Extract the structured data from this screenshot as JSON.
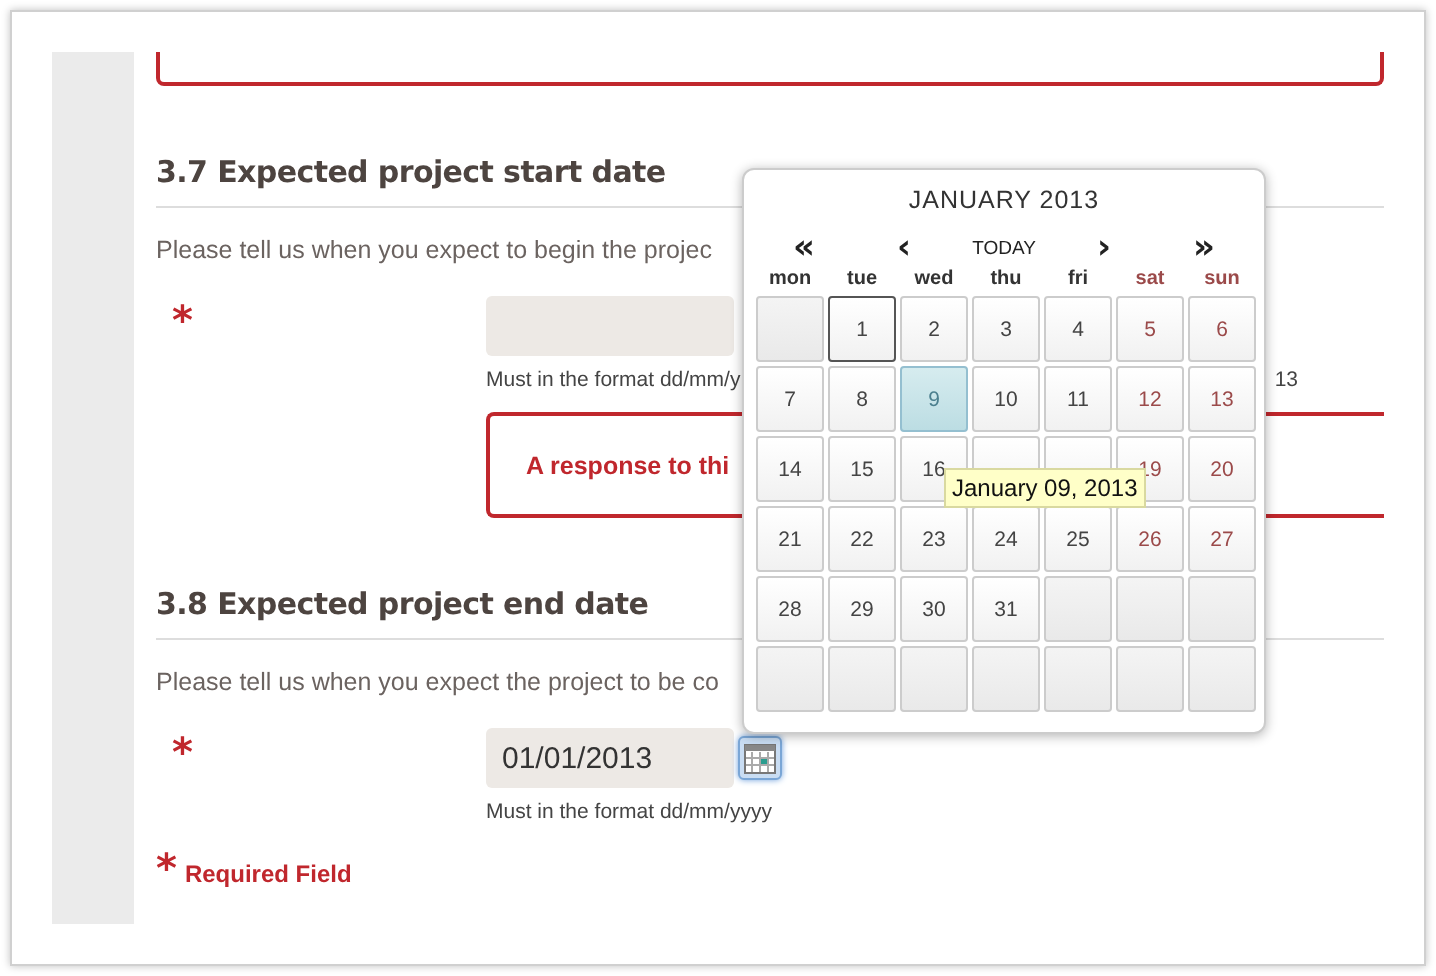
{
  "sections": [
    {
      "heading": "3.7 Expected project start date",
      "prompt": "Please tell us when you expect to begin the projec",
      "required_mark": "*",
      "field": {
        "hint": "Must in the format dd/mm/y",
        "hint_tail": "13"
      },
      "error": "A response to thi"
    },
    {
      "heading": "3.8 Expected project end date",
      "prompt": "Please tell us when you expect the project to be co",
      "required_mark": "*",
      "field": {
        "value": "01/01/2013",
        "picker_button": true,
        "picker_active": true,
        "hint": "Must in the format dd/mm/yyyy"
      }
    }
  ],
  "required_note": {
    "mark": "*",
    "text": "Required Field"
  },
  "calendar": {
    "title": "JANUARY 2013",
    "nav": [
      {
        "label": "«",
        "kind": "arrow"
      },
      {
        "label": "‹",
        "kind": "arrow"
      },
      {
        "label": "TODAY",
        "kind": "link"
      },
      {
        "label": "›",
        "kind": "arrow"
      },
      {
        "label": "»",
        "kind": "arrow"
      }
    ],
    "weekdays": [
      {
        "label": "mon",
        "weekend": false
      },
      {
        "label": "tue",
        "weekend": false
      },
      {
        "label": "wed",
        "weekend": false
      },
      {
        "label": "thu",
        "weekend": false
      },
      {
        "label": "fri",
        "weekend": false
      },
      {
        "label": "sat",
        "weekend": true
      },
      {
        "label": "sun",
        "weekend": true
      }
    ],
    "cells": [
      {
        "kind": "empty",
        "selected": false,
        "hovered": false
      },
      {
        "kind": "day",
        "day": "1",
        "weekend": false,
        "selected": true,
        "hovered": false
      },
      {
        "kind": "day",
        "day": "2",
        "weekend": false,
        "selected": false,
        "hovered": false
      },
      {
        "kind": "day",
        "day": "3",
        "weekend": false,
        "selected": false,
        "hovered": false
      },
      {
        "kind": "day",
        "day": "4",
        "weekend": false,
        "selected": false,
        "hovered": false
      },
      {
        "kind": "day",
        "day": "5",
        "weekend": true,
        "selected": false,
        "hovered": false
      },
      {
        "kind": "day",
        "day": "6",
        "weekend": true,
        "selected": false,
        "hovered": false
      },
      {
        "kind": "day",
        "day": "7",
        "weekend": false,
        "selected": false,
        "hovered": false
      },
      {
        "kind": "day",
        "day": "8",
        "weekend": false,
        "selected": false,
        "hovered": false
      },
      {
        "kind": "day",
        "day": "9",
        "weekend": false,
        "selected": false,
        "hovered": true
      },
      {
        "kind": "day",
        "day": "10",
        "weekend": false,
        "selected": false,
        "hovered": false
      },
      {
        "kind": "day",
        "day": "11",
        "weekend": false,
        "selected": false,
        "hovered": false
      },
      {
        "kind": "day",
        "day": "12",
        "weekend": true,
        "selected": false,
        "hovered": false
      },
      {
        "kind": "day",
        "day": "13",
        "weekend": true,
        "selected": false,
        "hovered": false
      },
      {
        "kind": "day",
        "day": "14",
        "weekend": false,
        "selected": false,
        "hovered": false
      },
      {
        "kind": "day",
        "day": "15",
        "weekend": false,
        "selected": false,
        "hovered": false
      },
      {
        "kind": "day",
        "day": "16",
        "weekend": false,
        "selected": false,
        "hovered": false
      },
      {
        "kind": "day",
        "selected": false,
        "hovered": false
      },
      {
        "kind": "day",
        "selected": false,
        "hovered": false
      },
      {
        "kind": "day",
        "day": "19",
        "weekend": true,
        "selected": false,
        "hovered": false
      },
      {
        "kind": "day",
        "day": "20",
        "weekend": true,
        "selected": false,
        "hovered": false
      },
      {
        "kind": "day",
        "day": "21",
        "weekend": false,
        "selected": false,
        "hovered": false
      },
      {
        "kind": "day",
        "day": "22",
        "weekend": false,
        "selected": false,
        "hovered": false
      },
      {
        "kind": "day",
        "day": "23",
        "weekend": false,
        "selected": false,
        "hovered": false
      },
      {
        "kind": "day",
        "day": "24",
        "weekend": false,
        "selected": false,
        "hovered": false
      },
      {
        "kind": "day",
        "day": "25",
        "weekend": false,
        "selected": false,
        "hovered": false
      },
      {
        "kind": "day",
        "day": "26",
        "weekend": true,
        "selected": false,
        "hovered": false
      },
      {
        "kind": "day",
        "day": "27",
        "weekend": true,
        "selected": false,
        "hovered": false
      },
      {
        "kind": "day",
        "day": "28",
        "weekend": false,
        "selected": false,
        "hovered": false
      },
      {
        "kind": "day",
        "day": "29",
        "weekend": false,
        "selected": false,
        "hovered": false
      },
      {
        "kind": "day",
        "day": "30",
        "weekend": false,
        "selected": false,
        "hovered": false
      },
      {
        "kind": "day",
        "day": "31",
        "weekend": false,
        "selected": false,
        "hovered": false
      },
      {
        "kind": "empty",
        "selected": false,
        "hovered": false
      },
      {
        "kind": "empty",
        "selected": false,
        "hovered": false
      },
      {
        "kind": "empty",
        "selected": false,
        "hovered": false
      },
      {
        "kind": "empty",
        "selected": false,
        "hovered": false
      },
      {
        "kind": "empty",
        "selected": false,
        "hovered": false
      },
      {
        "kind": "empty",
        "selected": false,
        "hovered": false
      },
      {
        "kind": "empty",
        "selected": false,
        "hovered": false
      },
      {
        "kind": "empty",
        "selected": false,
        "hovered": false
      },
      {
        "kind": "empty",
        "selected": false,
        "hovered": false
      },
      {
        "kind": "empty",
        "selected": false,
        "hovered": false
      }
    ],
    "tooltip": "January 09, 2013"
  }
}
